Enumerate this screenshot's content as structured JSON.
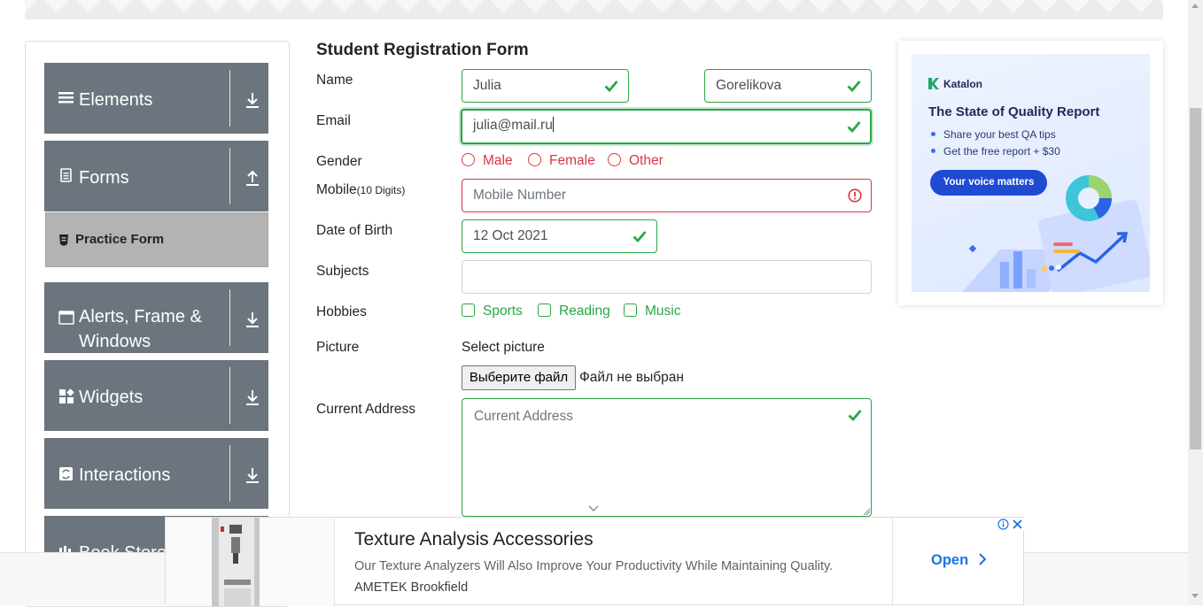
{
  "sidebar": {
    "groups": [
      {
        "label": "Elements",
        "icon": "hamburger-icon",
        "arrow": "down"
      },
      {
        "label": "Forms",
        "icon": "document-icon",
        "arrow": "up"
      },
      {
        "label": "Alerts, Frame & Windows",
        "icon": "window-icon",
        "arrow": "down"
      },
      {
        "label": "Widgets",
        "icon": "widgets-icon",
        "arrow": "down"
      },
      {
        "label": "Interactions",
        "icon": "refresh-icon",
        "arrow": "down"
      },
      {
        "label": "Book Store Application",
        "icon": "book-icon",
        "arrow": "down"
      }
    ],
    "active_item": {
      "label": "Practice Form",
      "icon": "html-icon"
    }
  },
  "form": {
    "title": "Student Registration Form",
    "name_label": "Name",
    "first_name": "Julia",
    "last_name": "Gorelikova",
    "email_label": "Email",
    "email": "julia@mail.ru",
    "gender_label": "Gender",
    "gender_options": [
      "Male",
      "Female",
      "Other"
    ],
    "mobile_label": "Mobile",
    "mobile_hint": "(10 Digits)",
    "mobile_placeholder": "Mobile Number",
    "dob_label": "Date of Birth",
    "dob": "12 Oct 2021",
    "subjects_label": "Subjects",
    "hobbies_label": "Hobbies",
    "hobbies_options": [
      "Sports",
      "Reading",
      "Music"
    ],
    "picture_label": "Picture",
    "picture_prompt": "Select picture",
    "file_button": "Выберите файл",
    "file_status": "Файл не выбран",
    "address_label": "Current Address",
    "address_placeholder": "Current Address"
  },
  "ad_right": {
    "brand": "Katalon",
    "heading": "The State of Quality Report",
    "bullets": [
      "Share your best QA tips",
      "Get the free report + $30"
    ],
    "cta": "Your voice matters"
  },
  "ad_bottom": {
    "title": "Texture Analysis Accessories",
    "description": "Our Texture Analyzers Will Also Improve Your Productivity While Maintaining Quality.",
    "advertiser": "AMETEK Brookfield",
    "cta": "Open"
  },
  "colors": {
    "valid": "#28a745",
    "invalid": "#dc3545",
    "sidebar_bg": "#6c757d",
    "active_bg": "#b3b3b3",
    "link": "#1a73e8"
  }
}
